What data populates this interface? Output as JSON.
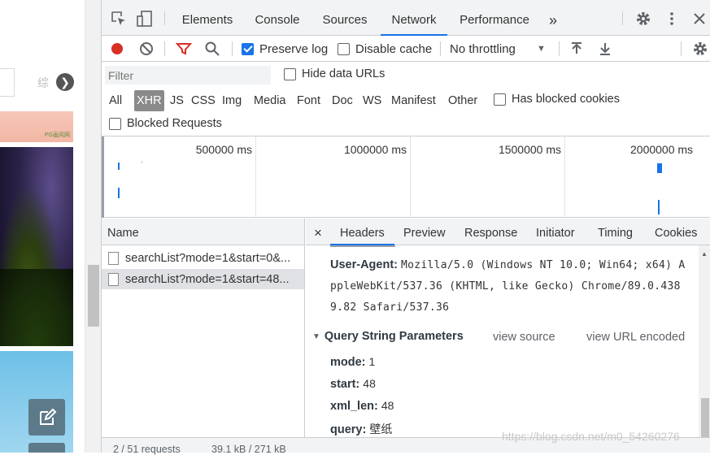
{
  "page": {
    "strip_partial_text": "综",
    "strip_next_glyph": "❯",
    "strip_signature": "PG画风网"
  },
  "main_tabs": [
    "Elements",
    "Console",
    "Sources",
    "Network",
    "Performance"
  ],
  "main_more": "»",
  "net_toolbar": {
    "preserve_log": "Preserve log",
    "disable_cache": "Disable cache",
    "throttling": "No throttling",
    "throttle_arrow": "▼"
  },
  "filter": {
    "placeholder": "Filter",
    "hide_data_urls": "Hide data URLs",
    "types": [
      "All",
      "XHR",
      "JS",
      "CSS",
      "Img",
      "Media",
      "Font",
      "Doc",
      "WS",
      "Manifest",
      "Other"
    ],
    "has_blocked_cookies": "Has blocked cookies",
    "blocked_requests": "Blocked Requests"
  },
  "overview": {
    "ticks": [
      "500000 ms",
      "1000000 ms",
      "1500000 ms",
      "2000000 ms"
    ]
  },
  "requests": {
    "header": "Name",
    "rows": [
      "searchList?mode=1&start=0&...",
      "searchList?mode=1&start=48..."
    ]
  },
  "status": {
    "requests": "2 / 51 requests",
    "transferred": "39.1 kB / 271 kB"
  },
  "detail": {
    "close": "×",
    "tabs": [
      "Headers",
      "Preview",
      "Response",
      "Initiator",
      "Timing",
      "Cookies"
    ],
    "user_agent_key": "User-Agent:",
    "user_agent_line1": "Mozilla/5.0 (Windows NT 10.0; Win64; x64) A",
    "user_agent_line2": "ppleWebKit/537.36 (KHTML, like Gecko) Chrome/89.0.438",
    "user_agent_line3": "9.82 Safari/537.36",
    "qsp_title": "Query String Parameters",
    "view_source": "view source",
    "view_url_encoded": "view URL encoded",
    "params": [
      {
        "key": "mode:",
        "value": "1"
      },
      {
        "key": "start:",
        "value": "48"
      },
      {
        "key": "xml_len:",
        "value": "48"
      },
      {
        "key": "query:",
        "value": "壁纸"
      }
    ]
  },
  "watermark": "https://blog.csdn.net/m0_54260276",
  "colors": {
    "accent": "#1a73e8",
    "record": "#d93025",
    "filter_icon": "#d93025",
    "toolbar_bg": "#f1f3f4",
    "selected_row": "#dfe1e5"
  }
}
